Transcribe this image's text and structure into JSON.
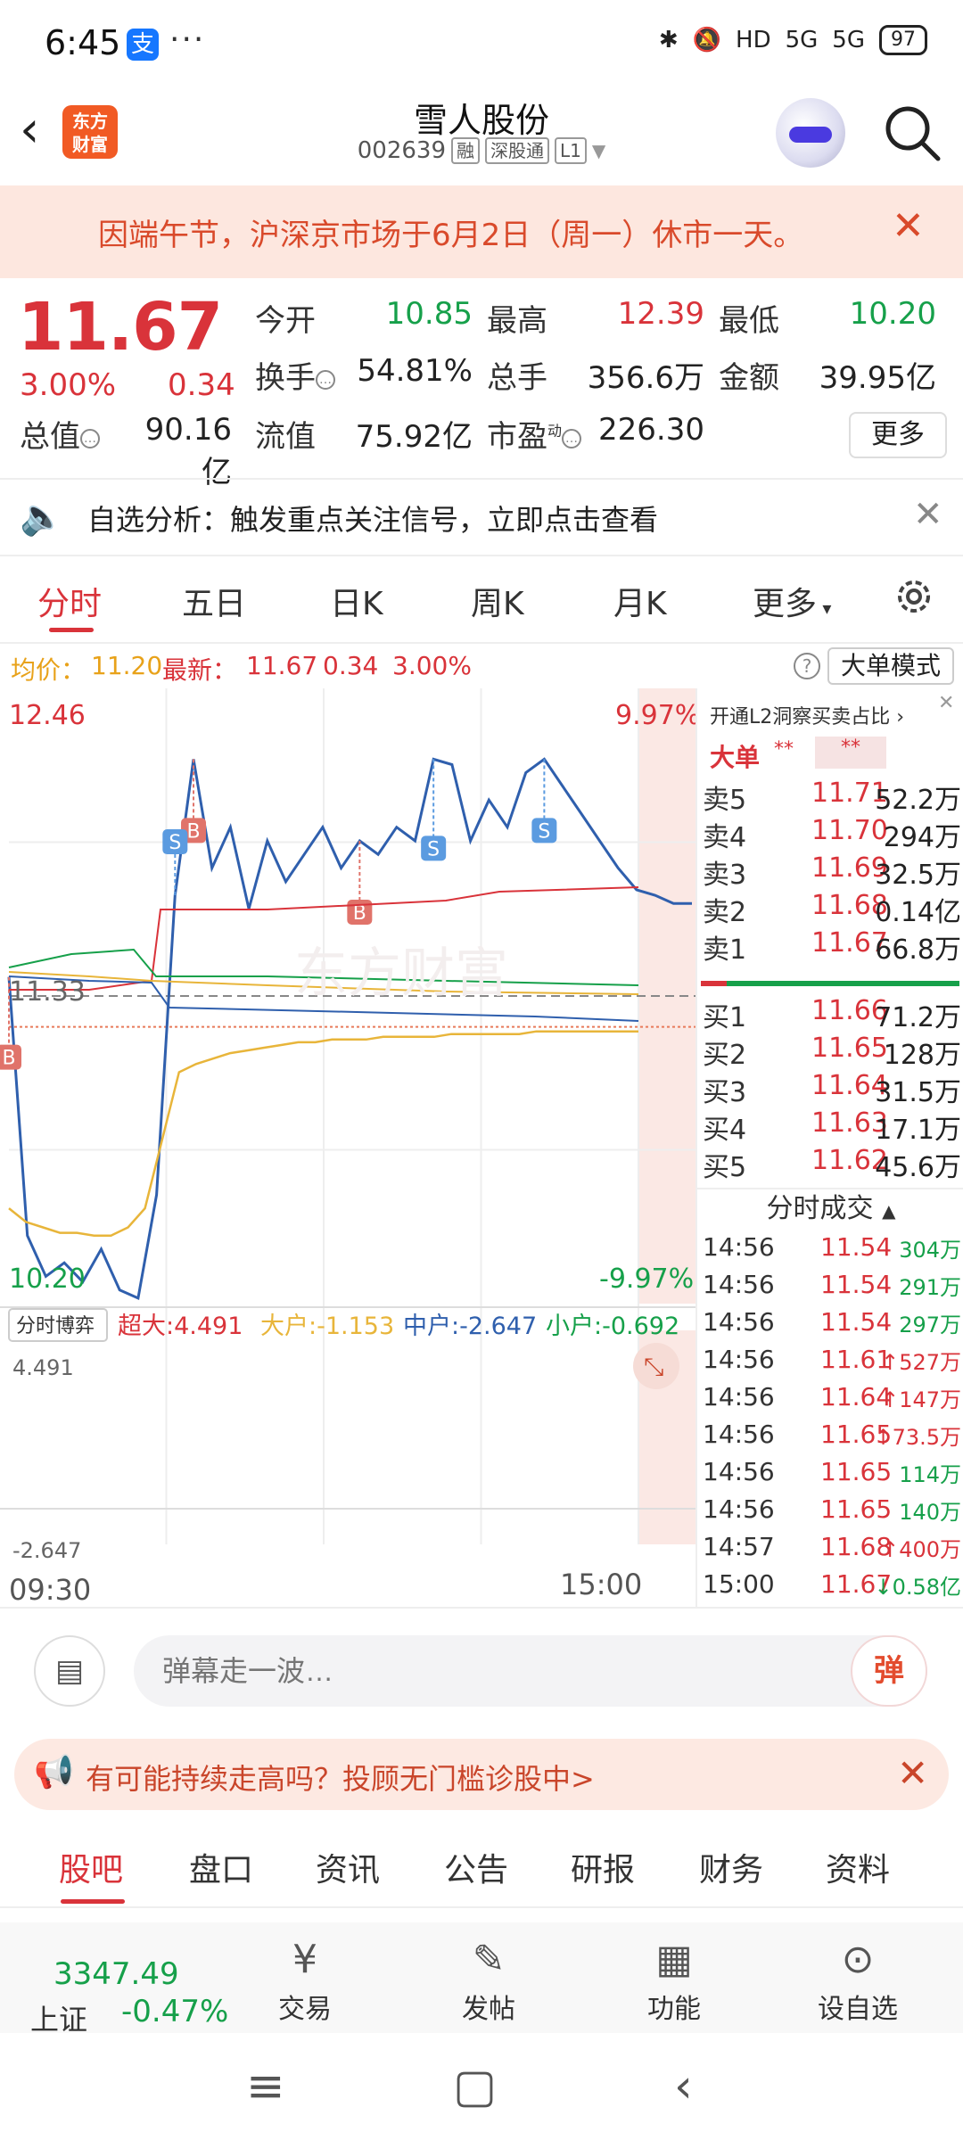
{
  "status": {
    "time": "6:45",
    "alipay_badge": "支",
    "more_dots": "···",
    "network_1": "HD",
    "network_2": "5G",
    "network_3": "5G",
    "battery": "97"
  },
  "header": {
    "logo_line1": "东方",
    "logo_line2": "财富",
    "name": "雪人股份",
    "code": "002639",
    "tags": [
      "融",
      "深股通",
      "L1"
    ]
  },
  "notice": {
    "text": "因端午节，沪深京市场于6月2日（周一）休市一天。"
  },
  "quote": {
    "price": "11.67",
    "change_pct": "3.00%",
    "change_amt": "0.34",
    "open_label": "今开",
    "open": "10.85",
    "high_label": "最高",
    "high": "12.39",
    "low_label": "最低",
    "low": "10.20",
    "turnover_label": "换手",
    "turnover": "54.81%",
    "volume_label": "总手",
    "volume": "356.6万",
    "amount_label": "金额",
    "amount": "39.95亿",
    "mktcap_label": "总值",
    "mktcap": "90.16亿",
    "float_label": "流值",
    "float": "75.92亿",
    "pe_label": "市盈",
    "pe_sup": "动",
    "pe": "226.30",
    "more": "更多"
  },
  "analysis": {
    "text": "自选分析：触发重点关注信号，立即点击查看"
  },
  "tabs": [
    "分时",
    "五日",
    "日K",
    "周K",
    "月K",
    "更多"
  ],
  "avgbar": {
    "avg_label": "均价：",
    "avg": "11.20",
    "last_label": "最新：",
    "last": "11.67",
    "chg": "0.34",
    "pct": "3.00%",
    "mode_btn": "大单模式"
  },
  "chart": {
    "top_price": "12.46",
    "top_pct": "9.97%",
    "mid_price": "11.33",
    "bottom_price": "10.20",
    "bottom_pct": "-9.97%",
    "watermark": "东方财富",
    "flow_label": "分时博弈",
    "flow_super": "超大:4.491",
    "flow_big": "大户:-1.153",
    "flow_mid": "中户:-2.647",
    "flow_small": "小户:-0.692",
    "flow_top": "4.491",
    "flow_bottom": "-2.647",
    "time_start": "09:30",
    "time_end": "15:00",
    "marker_b": "B",
    "marker_s": "S"
  },
  "chart_data": {
    "type": "line",
    "title": "",
    "x_range": [
      "09:30",
      "15:00"
    ],
    "ylim": [
      10.2,
      12.46
    ],
    "pre_close": 11.33,
    "series": [
      {
        "name": "",
        "values": [
          11.4,
          10.45,
          10.3,
          10.35,
          10.28,
          10.4,
          10.25,
          10.22,
          10.6,
          11.7,
          12.2,
          11.8,
          11.95,
          11.65,
          11.9,
          11.75,
          11.85,
          11.95,
          11.8,
          11.9,
          11.85,
          11.95,
          11.9,
          12.2,
          12.18,
          11.9,
          12.05,
          11.95,
          12.15,
          12.2,
          12.1,
          12.0,
          11.9,
          11.8,
          11.72,
          11.7,
          11.67,
          11.67
        ]
      },
      {
        "name": "",
        "values": [
          10.55,
          10.5,
          10.48,
          10.46,
          10.46,
          10.45,
          10.45,
          10.48,
          10.55,
          10.8,
          11.05,
          11.08,
          11.1,
          11.12,
          11.13,
          11.14,
          11.15,
          11.16,
          11.16,
          11.17,
          11.17,
          11.17,
          11.18,
          11.18,
          11.18,
          11.18,
          11.19,
          11.19,
          11.19,
          11.19,
          11.19,
          11.2,
          11.2,
          11.2,
          11.2,
          11.2,
          11.2,
          11.2
        ]
      }
    ]
  },
  "orderbook": {
    "link": "开通L2洞察买卖占比",
    "big_order": "大单",
    "stars1": "**",
    "stars2": "**",
    "asks": [
      {
        "label": "卖5",
        "price": "11.71",
        "vol": "52.2万"
      },
      {
        "label": "卖4",
        "price": "11.70",
        "vol": "294万"
      },
      {
        "label": "卖3",
        "price": "11.69",
        "vol": "32.5万"
      },
      {
        "label": "卖2",
        "price": "11.68",
        "vol": "0.14亿"
      },
      {
        "label": "卖1",
        "price": "11.67",
        "vol": "66.8万"
      }
    ],
    "bids": [
      {
        "label": "买1",
        "price": "11.66",
        "vol": "71.2万"
      },
      {
        "label": "买2",
        "price": "11.65",
        "vol": "128万"
      },
      {
        "label": "买3",
        "price": "11.64",
        "vol": "31.5万"
      },
      {
        "label": "买4",
        "price": "11.63",
        "vol": "17.1万"
      },
      {
        "label": "买5",
        "price": "11.62",
        "vol": "45.6万"
      }
    ],
    "trades_title": "分时成交",
    "trades": [
      {
        "time": "14:56",
        "price": "11.54",
        "vol": "304万",
        "dir": ""
      },
      {
        "time": "14:56",
        "price": "11.54",
        "vol": "291万",
        "dir": ""
      },
      {
        "time": "14:56",
        "price": "11.54",
        "vol": "297万",
        "dir": ""
      },
      {
        "time": "14:56",
        "price": "11.61",
        "vol": "527万",
        "dir": "↑"
      },
      {
        "time": "14:56",
        "price": "11.64",
        "vol": "147万",
        "dir": "↑"
      },
      {
        "time": "14:56",
        "price": "11.65",
        "vol": "73.5万",
        "dir": "↑"
      },
      {
        "time": "14:56",
        "price": "11.65",
        "vol": "114万",
        "dir": ""
      },
      {
        "time": "14:56",
        "price": "11.65",
        "vol": "140万",
        "dir": ""
      },
      {
        "time": "14:57",
        "price": "11.68",
        "vol": "400万",
        "dir": "↑"
      },
      {
        "time": "15:00",
        "price": "11.67",
        "vol": "0.58亿",
        "dir": "↓"
      }
    ]
  },
  "danmu": {
    "placeholder": "弹幕走一波…",
    "send": "弹"
  },
  "promo": {
    "text": "有可能持续走高吗？投顾无门槛诊股中>"
  },
  "bottom_tabs": [
    "股吧",
    "盘口",
    "资讯",
    "公告",
    "研报",
    "财务",
    "资料"
  ],
  "dock": {
    "index_value": "3347.49",
    "index_name": "上证",
    "index_pct": "-0.47%",
    "items": [
      "交易",
      "发帖",
      "功能",
      "设自选"
    ]
  },
  "colors": {
    "up": "#d9333a",
    "down": "#16a04a",
    "accent": "#f15a24",
    "price_line": "#2f5fad",
    "avg_line": "#e8b53a"
  }
}
